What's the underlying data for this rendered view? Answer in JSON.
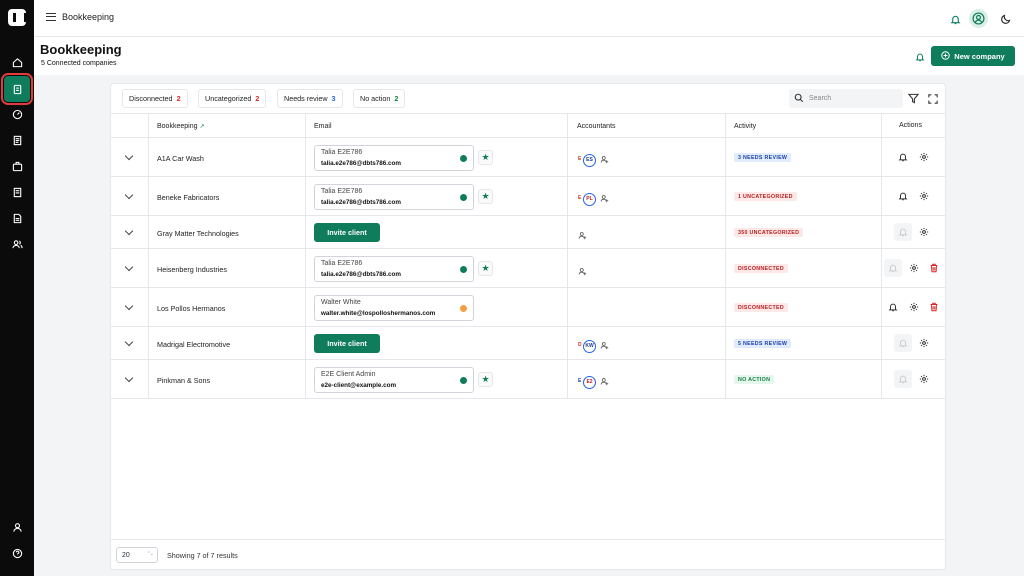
{
  "topbar": {
    "breadcrumb": "Bookkeeping"
  },
  "header": {
    "title": "Bookkeeping",
    "subtitle": "5 Connected companies",
    "new_company_label": "New company"
  },
  "filters": [
    {
      "label": "Disconnected",
      "count": "2"
    },
    {
      "label": "Uncategorized",
      "count": "2"
    },
    {
      "label": "Needs review",
      "count": "3"
    },
    {
      "label": "No action",
      "count": "2"
    }
  ],
  "search": {
    "placeholder": "Search"
  },
  "columns": {
    "bookkeeping": "Bookkeeping",
    "email": "Email",
    "accountants": "Accountants",
    "activity": "Activity",
    "actions": "Actions"
  },
  "rows": [
    {
      "name": "A1A Car Wash",
      "contact_name": "Talia E2E786",
      "contact_email": "talia.e2e786@dbts786.com",
      "status": "green",
      "avatar_primary": "ES",
      "avatar_secondary": "E",
      "activity": "3 NEEDS REVIEW"
    },
    {
      "name": "Beneke Fabricators",
      "contact_name": "Talia E2E786",
      "contact_email": "talia.e2e786@dbts786.com",
      "status": "green",
      "avatar_primary": "PL",
      "avatar_secondary": "E",
      "activity": "1 UNCATEGORIZED"
    },
    {
      "name": "Gray Matter Technologies",
      "invite_label": "Invite client",
      "activity": "350 UNCATEGORIZED"
    },
    {
      "name": "Heisenberg Industries",
      "contact_name": "Talia E2E786",
      "contact_email": "talia.e2e786@dbts786.com",
      "status": "green",
      "activity": "DISCONNECTED"
    },
    {
      "name": "Los Pollos Hermanos",
      "contact_name": "Walter White",
      "contact_email": "walter.white@lospolloshermanos.com",
      "status": "orange",
      "activity": "DISCONNECTED"
    },
    {
      "name": "Madrigal Electromotive",
      "invite_label": "Invite client",
      "avatar_primary": "KW",
      "avatar_secondary": "D",
      "activity": "5 NEEDS REVIEW"
    },
    {
      "name": "Pinkman & Sons",
      "contact_name": "E2E Client Admin",
      "contact_email": "e2e-client@example.com",
      "status": "green",
      "avatar_primary": "E2",
      "avatar_secondary": "E",
      "activity": "NO ACTION"
    }
  ],
  "footer": {
    "per_page": "20",
    "summary": "Showing 7 of 7 results"
  },
  "colors": {
    "brand": "#0f7c5c",
    "status_green": "#0f7c5c",
    "status_orange": "#f59e42",
    "danger": "#dc2626"
  }
}
